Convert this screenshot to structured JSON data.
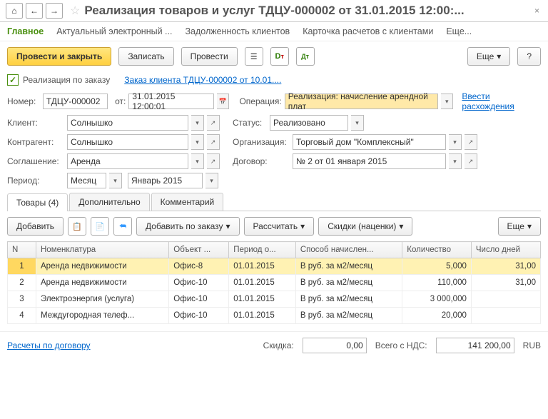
{
  "header": {
    "title": "Реализация товаров и услуг ТДЦУ-000002 от 31.01.2015 12:00:..."
  },
  "navtabs": {
    "t0": "Главное",
    "t1": "Актуальный электронный ...",
    "t2": "Задолженность клиентов",
    "t3": "Карточка расчетов с клиентами",
    "t4": "Еще..."
  },
  "toolbar": {
    "post_close": "Провести и закрыть",
    "write": "Записать",
    "post": "Провести",
    "more": "Еще",
    "help": "?"
  },
  "orderline": {
    "label": "Реализация по заказу",
    "link": "Заказ клиента ТДЦУ-000002 от 10.01...."
  },
  "fields": {
    "number_lbl": "Номер:",
    "number": "ТДЦУ-000002",
    "ot_lbl": "от:",
    "date": "31.01.2015 12:00:01",
    "operation_lbl": "Операция:",
    "operation": "Реализация: начисление арендной плат",
    "diff_link": "Ввести расхождения",
    "client_lbl": "Клиент:",
    "client": "Солнышко",
    "status_lbl": "Статус:",
    "status": "Реализовано",
    "contr_lbl": "Контрагент:",
    "contr": "Солнышко",
    "org_lbl": "Организация:",
    "org": "Торговый дом \"Комплексный\"",
    "agree_lbl": "Соглашение:",
    "agree": "Аренда",
    "dogovor_lbl": "Договор:",
    "dogovor": "№ 2 от 01 января 2015",
    "period_lbl": "Период:",
    "period_type": "Месяц",
    "period_val": "Январь 2015"
  },
  "tabs": {
    "t0": "Товары (4)",
    "t1": "Дополнительно",
    "t2": "Комментарий"
  },
  "subtb": {
    "add": "Добавить",
    "add_by_order": "Добавить по заказу",
    "calc": "Рассчитать",
    "discounts": "Скидки (наценки)",
    "more": "Еще"
  },
  "grid": {
    "h0": "N",
    "h1": "Номенклатура",
    "h2": "Объект ...",
    "h3": "Период о...",
    "h4": "Способ начислен...",
    "h5": "Количество",
    "h6": "Число дней",
    "rows": [
      {
        "n": "1",
        "nom": "Аренда недвижимости",
        "obj": "Офис-8",
        "per": "01.01.2015",
        "sp": "В руб. за м2/месяц",
        "qty": "5,000",
        "days": "31,00"
      },
      {
        "n": "2",
        "nom": "Аренда недвижимости",
        "obj": "Офис-10",
        "per": "01.01.2015",
        "sp": "В руб. за м2/месяц",
        "qty": "110,000",
        "days": "31,00"
      },
      {
        "n": "3",
        "nom": "Электроэнергия (услуга)",
        "obj": "Офис-10",
        "per": "01.01.2015",
        "sp": "В руб. за м2/месяц",
        "qty": "3 000,000",
        "days": ""
      },
      {
        "n": "4",
        "nom": "Междугородная телеф...",
        "obj": "Офис-10",
        "per": "01.01.2015",
        "sp": "В руб. за м2/месяц",
        "qty": "20,000",
        "days": ""
      }
    ]
  },
  "footer": {
    "calc_link": "Расчеты по договору",
    "discount_lbl": "Скидка:",
    "discount": "0,00",
    "total_lbl": "Всего с НДС:",
    "total": "141 200,00",
    "currency": "RUB"
  }
}
